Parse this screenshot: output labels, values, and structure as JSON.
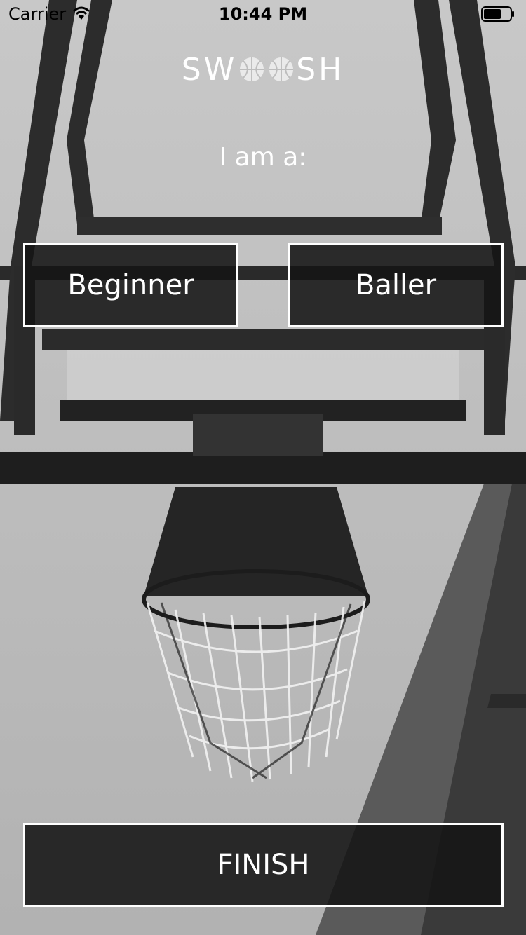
{
  "status_bar": {
    "carrier": "Carrier",
    "time": "10:44 PM",
    "wifi_icon": "wifi-icon",
    "battery_icon": "battery-icon"
  },
  "logo": {
    "text_start": "SW",
    "text_end": "SH",
    "ball_icon": "basketball-icon"
  },
  "prompt": "I am a:",
  "buttons": {
    "beginner": "Beginner",
    "baller": "Baller",
    "finish": "FINISH"
  },
  "colors": {
    "button_bg": "#141414",
    "button_border": "#ffffff",
    "text": "#ffffff"
  }
}
